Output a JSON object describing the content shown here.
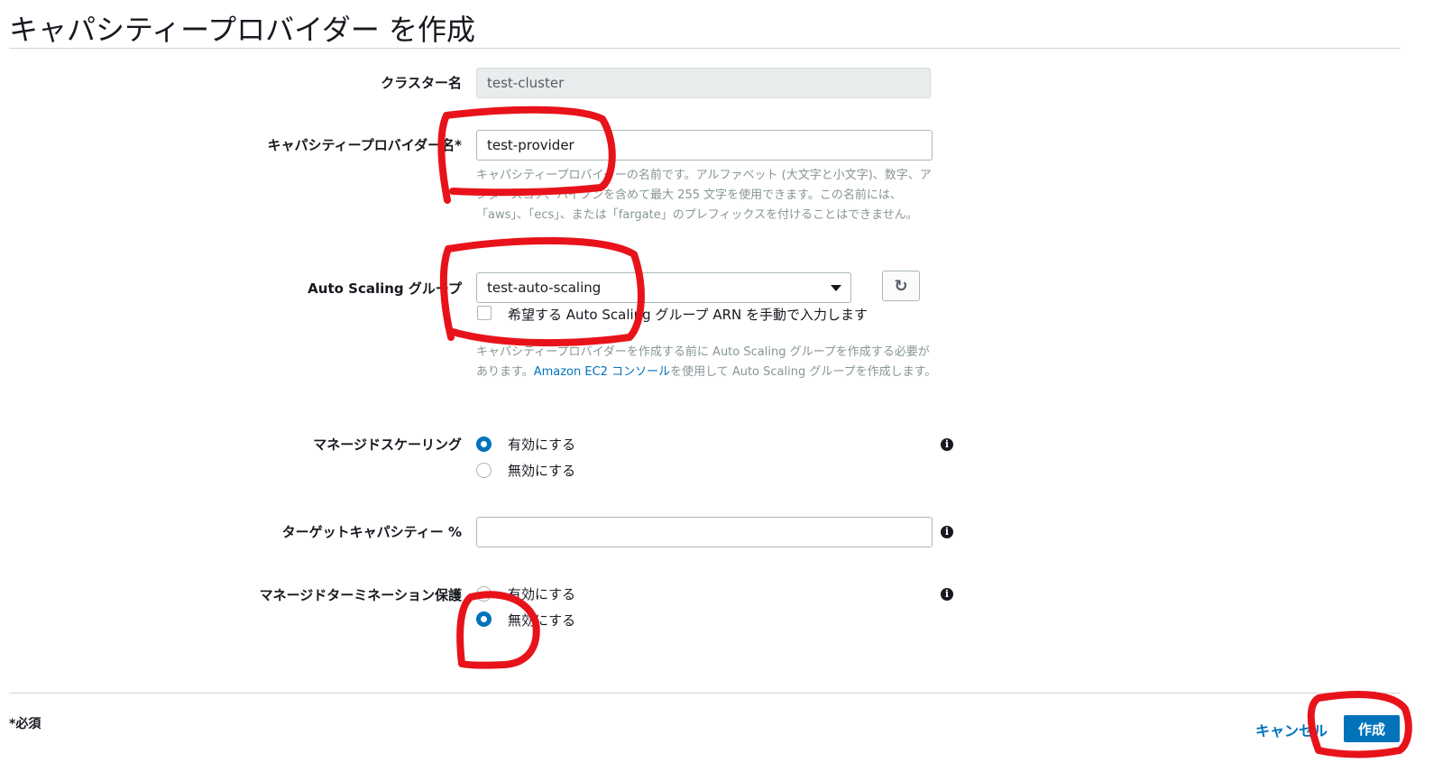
{
  "page": {
    "title": "キャパシティープロバイダー を作成"
  },
  "form": {
    "cluster_name": {
      "label": "クラスター名",
      "value": "test-cluster"
    },
    "provider_name": {
      "label": "キャパシティープロバイダー名*",
      "value": "test-provider",
      "help": "キャパシティープロバイダーの名前です。アルファベット (大文字と小文字)、数字、アンダースコア、ハイフンを含めて最大 255 文字を使用できます。この名前には、「aws」、「ecs」、または「fargate」のプレフィックスを付けることはできません。"
    },
    "asg": {
      "label": "Auto Scaling グループ",
      "selected": "test-auto-scaling",
      "manual_arn_label": "希望する Auto Scaling グループ ARN を手動で入力します",
      "help_prefix": "キャパシティープロバイダーを作成する前に Auto Scaling グループを作成する必要があります。",
      "help_link": "Amazon EC2 コンソール",
      "help_suffix": "を使用して Auto Scaling グループを作成します。",
      "refresh_icon": "refresh-icon"
    },
    "managed_scaling": {
      "label": "マネージドスケーリング",
      "options": [
        {
          "label": "有効にする",
          "checked": true
        },
        {
          "label": "無効にする",
          "checked": false
        }
      ]
    },
    "target_capacity": {
      "label": "ターゲットキャパシティー %",
      "value": ""
    },
    "managed_termination_protection": {
      "label": "マネージドターミネーション保護",
      "options": [
        {
          "label": "有効にする",
          "checked": false
        },
        {
          "label": "無効にする",
          "checked": true
        }
      ]
    },
    "info_icon": "i"
  },
  "footer": {
    "required_note": "*必須",
    "cancel_label": "キャンセル",
    "create_label": "作成"
  },
  "colors": {
    "accent": "#0073bb",
    "annotation": "#e8131a"
  }
}
